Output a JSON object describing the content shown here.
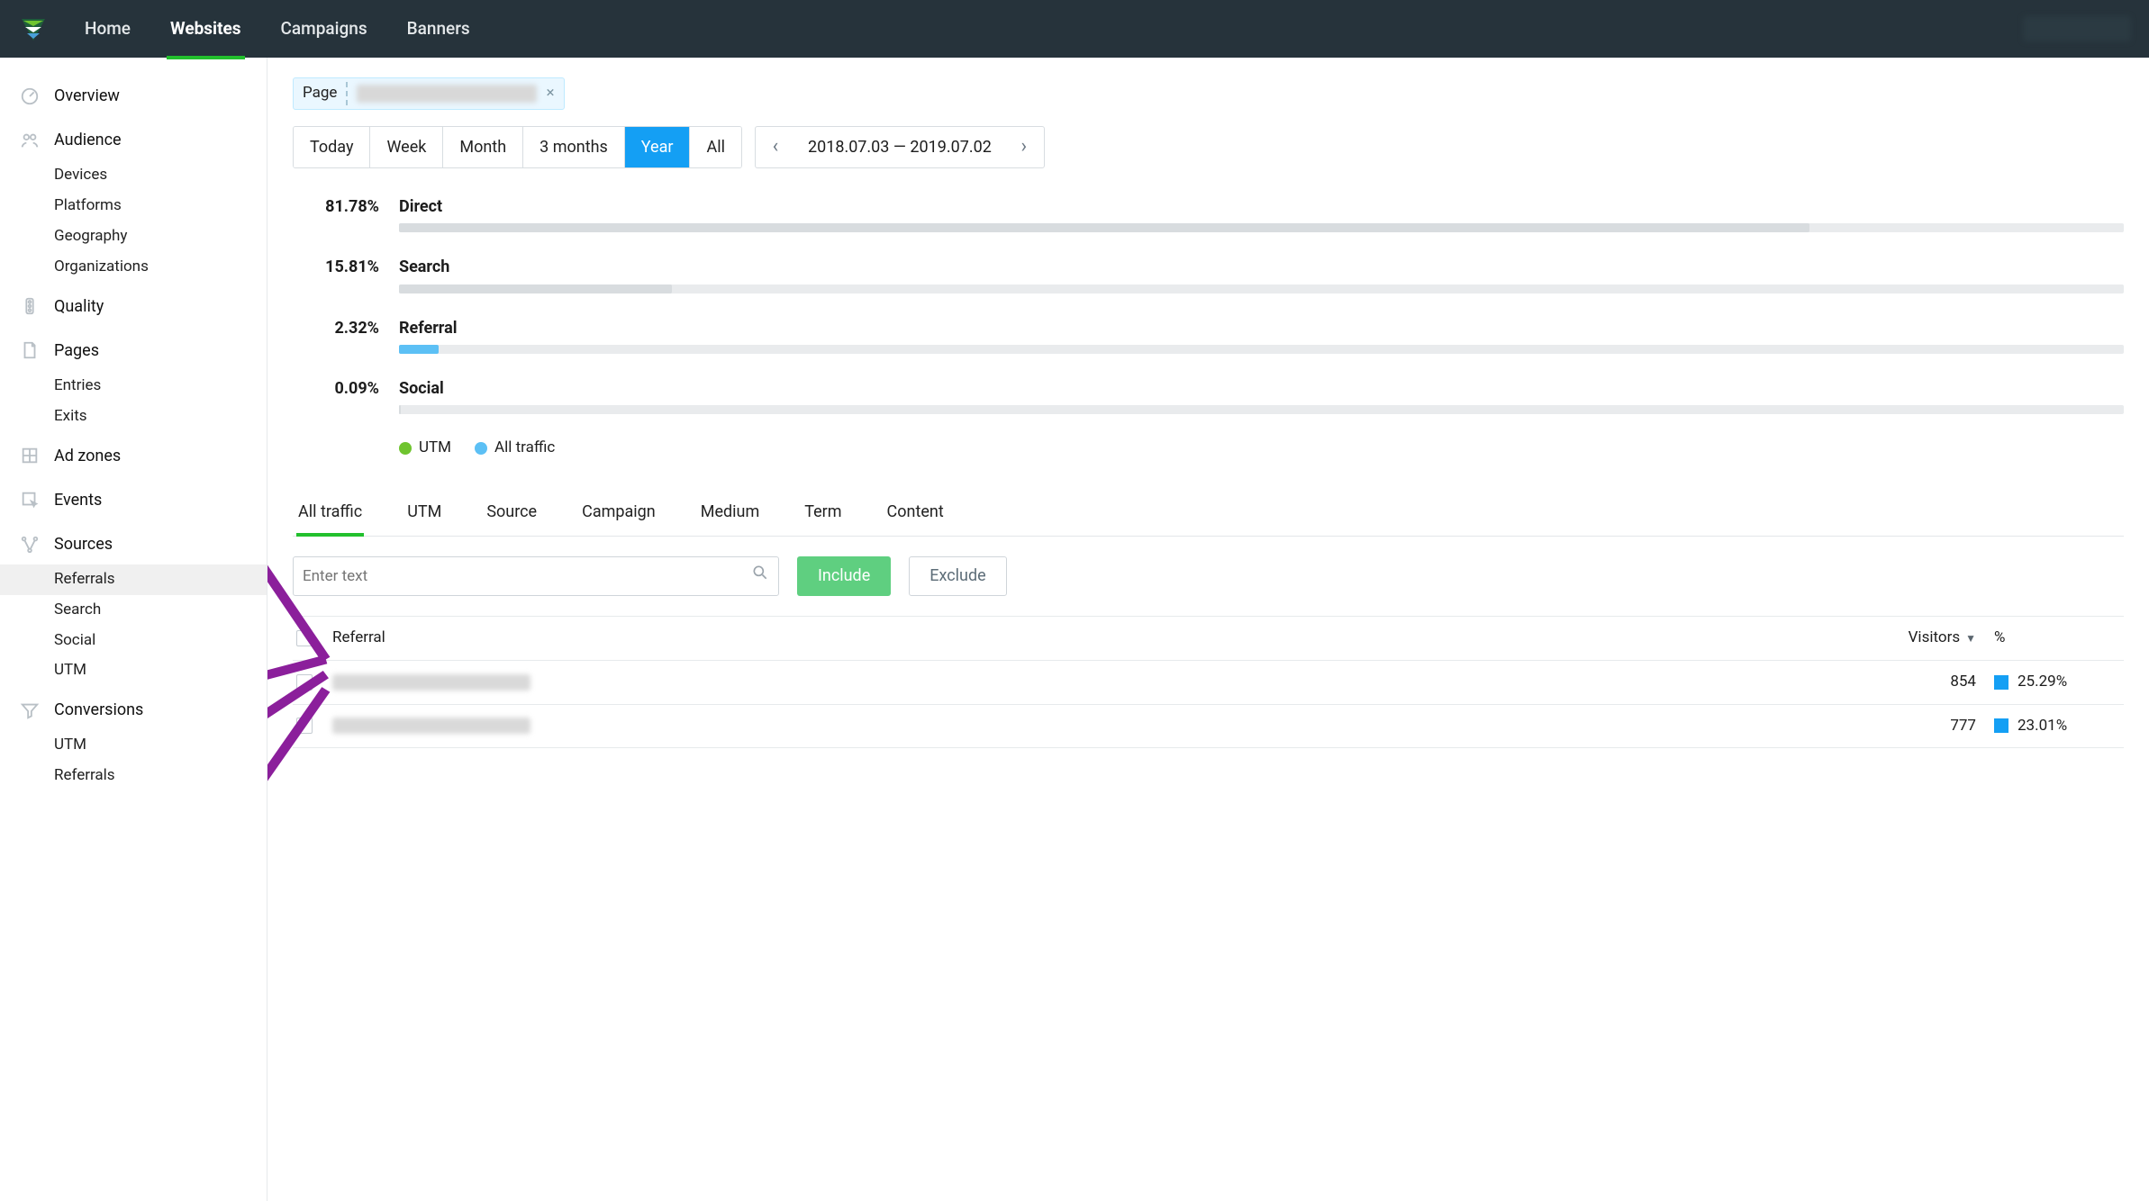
{
  "topnav": {
    "items": [
      "Home",
      "Websites",
      "Campaigns",
      "Banners"
    ],
    "active_index": 1
  },
  "sidebar": {
    "overview": "Overview",
    "audience": {
      "label": "Audience",
      "items": [
        "Devices",
        "Platforms",
        "Geography",
        "Organizations"
      ]
    },
    "quality": "Quality",
    "pages": {
      "label": "Pages",
      "items": [
        "Entries",
        "Exits"
      ]
    },
    "adzones": "Ad zones",
    "events": "Events",
    "sources": {
      "label": "Sources",
      "items": [
        "Referrals",
        "Search",
        "Social",
        "UTM"
      ],
      "selected": "Referrals"
    },
    "conversions": {
      "label": "Conversions",
      "items": [
        "UTM",
        "Referrals"
      ]
    }
  },
  "page_filter": {
    "label": "Page",
    "close": "×"
  },
  "date": {
    "segments": [
      "Today",
      "Week",
      "Month",
      "3 months",
      "Year",
      "All"
    ],
    "active": "Year",
    "range": "2018.07.03 — 2019.07.02"
  },
  "chart_data": {
    "type": "bar",
    "title": "",
    "xlabel": "",
    "ylabel": "",
    "categories": [
      "Direct",
      "Search",
      "Referral",
      "Social"
    ],
    "values": [
      81.78,
      15.81,
      2.32,
      0.09
    ],
    "series": [
      {
        "name": "Direct",
        "pct": 81.78,
        "utm": 0,
        "all": 81.78,
        "color": "#d8dcdf"
      },
      {
        "name": "Search",
        "pct": 15.81,
        "utm": 0,
        "all": 15.81,
        "color": "#d8dcdf"
      },
      {
        "name": "Referral",
        "pct": 2.32,
        "utm": 2.32,
        "all": 0,
        "color": "#5cc0f5"
      },
      {
        "name": "Social",
        "pct": 0.09,
        "utm": 0,
        "all": 0.09,
        "color": "#d8dcdf"
      }
    ],
    "legend": [
      {
        "name": "UTM",
        "color": "#6fc42f"
      },
      {
        "name": "All traffic",
        "color": "#5cc0f5"
      }
    ]
  },
  "tabs": {
    "items": [
      "All traffic",
      "UTM",
      "Source",
      "Campaign",
      "Medium",
      "Term",
      "Content"
    ],
    "active": "All traffic"
  },
  "filter": {
    "placeholder": "Enter text",
    "include": "Include",
    "exclude": "Exclude"
  },
  "table": {
    "columns": {
      "referral": "Referral",
      "visitors": "Visitors",
      "pct": "%"
    },
    "sort_col": "Visitors",
    "rows": [
      {
        "visitors": 854,
        "pct": "25.29%"
      },
      {
        "visitors": 777,
        "pct": "23.01%"
      }
    ]
  },
  "colors": {
    "accent_green": "#22c02d",
    "accent_blue": "#149ff4",
    "purple": "#8b1f9b"
  }
}
